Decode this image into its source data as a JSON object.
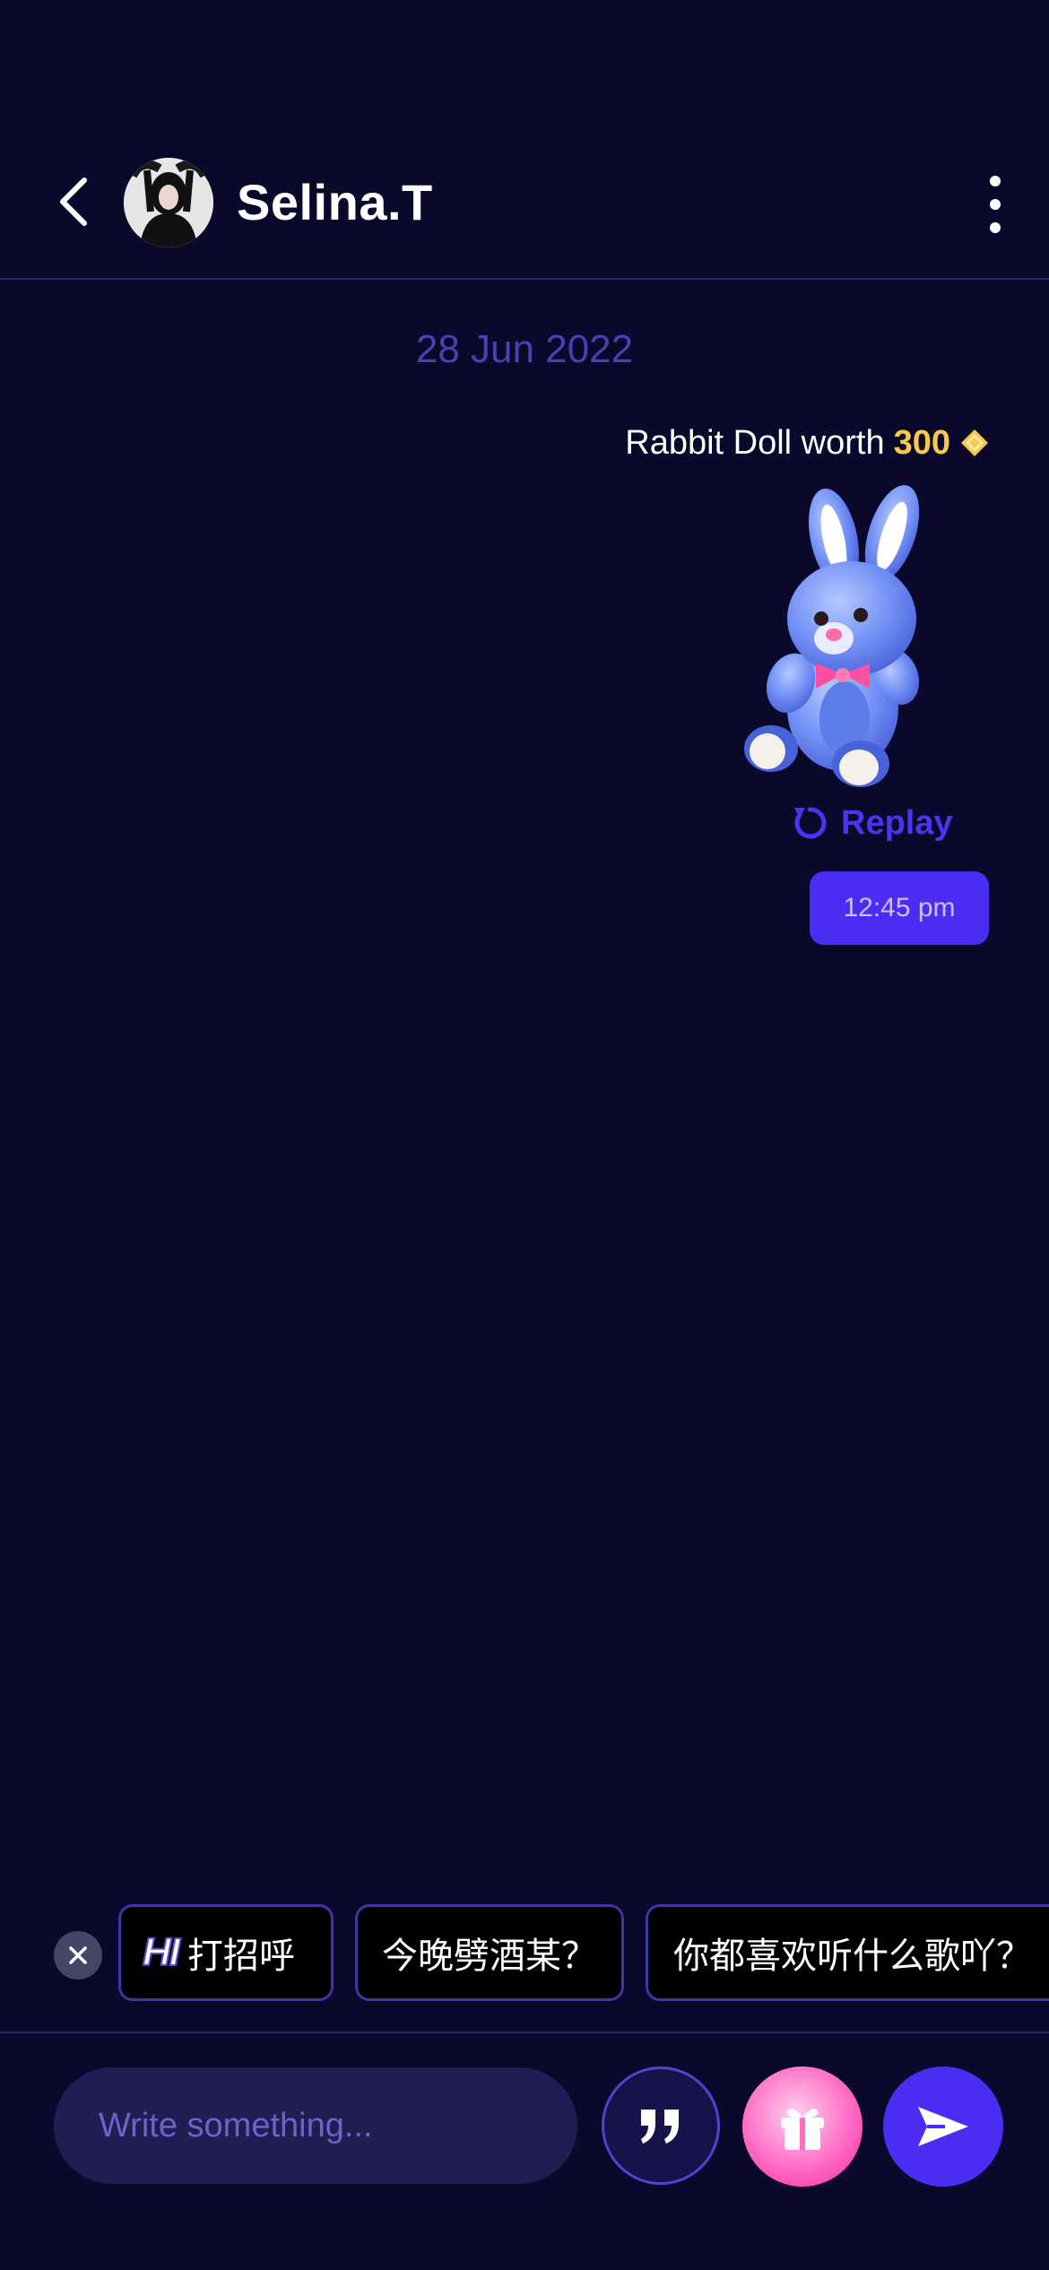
{
  "header": {
    "contact_name": "Selina.T",
    "icons": [
      "chevron-left-icon",
      "more-vertical-icon"
    ]
  },
  "chat": {
    "date": "28 Jun 2022",
    "gift_message": {
      "text_prefix": "Rabbit Doll worth",
      "value": "300",
      "currency_icon": "diamond-icon",
      "sticker": "rabbit-doll"
    },
    "replay_label": "Replay",
    "time": "12:45 pm"
  },
  "suggestions": {
    "hi_badge": "HI",
    "items": [
      "打招呼",
      "今晚劈酒某？",
      "你都喜欢听什么歌吖？"
    ]
  },
  "composer": {
    "placeholder": "Write something...",
    "buttons": [
      "quote-icon",
      "gift-icon",
      "send-icon"
    ]
  },
  "colors": {
    "background": "#0a082b",
    "accent": "#4a2cf2",
    "gold": "#f7c84a",
    "muted_purple": "#4b3fb3",
    "gift_pink": "#ff6cc6"
  }
}
